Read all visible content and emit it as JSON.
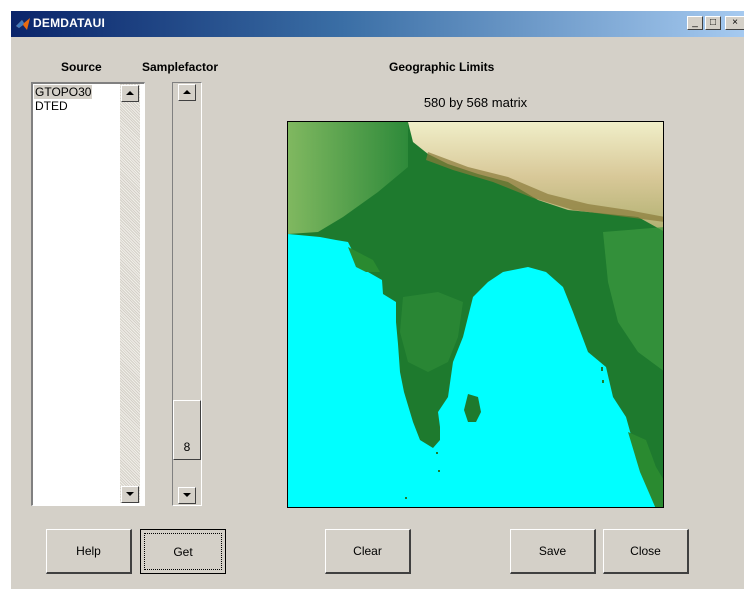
{
  "window": {
    "title": "DEMDATAUI",
    "controls": {
      "minimize": "_",
      "maximize": "□",
      "close": "×"
    }
  },
  "source": {
    "label": "Source",
    "items": [
      "GTOPO30",
      "DTED"
    ],
    "selected_index": 0
  },
  "samplefactor": {
    "label": "Samplefactor",
    "value": "8"
  },
  "geographic_limits": {
    "label": "Geographic Limits",
    "matrix_size": "580 by 568 matrix"
  },
  "buttons": {
    "help": "Help",
    "get": "Get",
    "clear": "Clear",
    "save": "Save",
    "close": "Close"
  },
  "icons": {
    "title_icon": "matlab-logo-icon",
    "scroll_up": "arrow-up-icon",
    "scroll_down": "arrow-down-icon"
  },
  "colors": {
    "title_gradient_start": "#0a246a",
    "title_gradient_end": "#a6caf0",
    "window_bg": "#d4d0c8",
    "ocean": "#00ffff",
    "lowland": "#1e7a2e",
    "highland": "#e8e6b0"
  }
}
